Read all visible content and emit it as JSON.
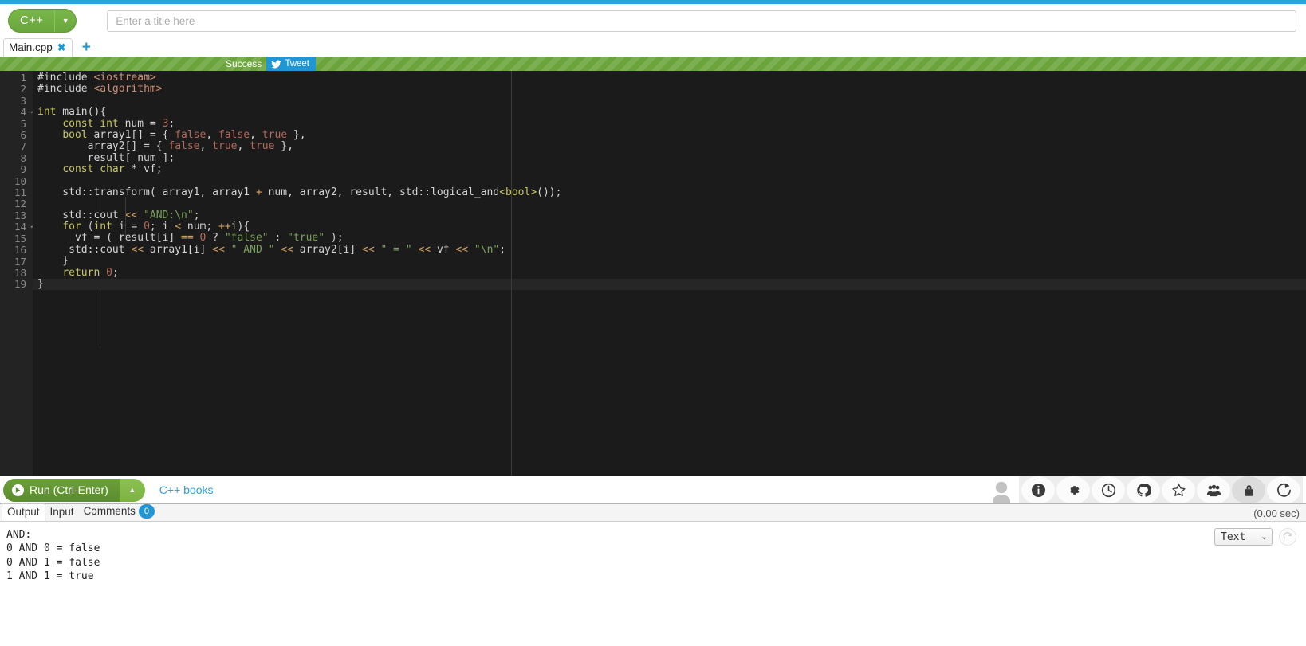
{
  "header": {
    "language": "C++",
    "language_caret": "▼",
    "title_placeholder": "Enter a title here",
    "title_value": ""
  },
  "tabs": {
    "files": [
      {
        "name": "Main.cpp",
        "close": "✖"
      }
    ],
    "add_label": "+"
  },
  "status": {
    "text": "Success",
    "tweet_label": "Tweet"
  },
  "editor": {
    "line_numbers": [
      "1",
      "2",
      "3",
      "4",
      "5",
      "6",
      "7",
      "8",
      "9",
      "10",
      "11",
      "12",
      "13",
      "14",
      "15",
      "16",
      "17",
      "18",
      "19"
    ],
    "lines": [
      [
        {
          "t": "#include ",
          "c": "t-pre"
        },
        {
          "t": "<iostream>",
          "c": "t-inc"
        }
      ],
      [
        {
          "t": "#include ",
          "c": "t-pre"
        },
        {
          "t": "<algorithm>",
          "c": "t-inc"
        }
      ],
      [],
      [
        {
          "t": "int",
          "c": "t-kw"
        },
        {
          "t": " main(){",
          "c": "t-plain"
        }
      ],
      [
        {
          "t": "    ",
          "c": "t-plain"
        },
        {
          "t": "const int",
          "c": "t-kw"
        },
        {
          "t": " num = ",
          "c": "t-plain"
        },
        {
          "t": "3",
          "c": "t-num"
        },
        {
          "t": ";",
          "c": "t-plain"
        }
      ],
      [
        {
          "t": "    ",
          "c": "t-plain"
        },
        {
          "t": "bool",
          "c": "t-kw"
        },
        {
          "t": " array1[] = { ",
          "c": "t-plain"
        },
        {
          "t": "false",
          "c": "t-bool"
        },
        {
          "t": ", ",
          "c": "t-plain"
        },
        {
          "t": "false",
          "c": "t-bool"
        },
        {
          "t": ", ",
          "c": "t-plain"
        },
        {
          "t": "true",
          "c": "t-bool"
        },
        {
          "t": " },",
          "c": "t-plain"
        }
      ],
      [
        {
          "t": "        array2[] = { ",
          "c": "t-plain"
        },
        {
          "t": "false",
          "c": "t-bool"
        },
        {
          "t": ", ",
          "c": "t-plain"
        },
        {
          "t": "true",
          "c": "t-bool"
        },
        {
          "t": ", ",
          "c": "t-plain"
        },
        {
          "t": "true",
          "c": "t-bool"
        },
        {
          "t": " },",
          "c": "t-plain"
        }
      ],
      [
        {
          "t": "        result[ num ];",
          "c": "t-plain"
        }
      ],
      [
        {
          "t": "    ",
          "c": "t-plain"
        },
        {
          "t": "const char",
          "c": "t-kw"
        },
        {
          "t": " * vf;",
          "c": "t-plain"
        }
      ],
      [],
      [
        {
          "t": "    std::transform( array1, array1 ",
          "c": "t-plain"
        },
        {
          "t": "+",
          "c": "t-op"
        },
        {
          "t": " num, array2, result, std::logical_and",
          "c": "t-plain"
        },
        {
          "t": "<bool>",
          "c": "t-tmpl"
        },
        {
          "t": "());",
          "c": "t-plain"
        }
      ],
      [],
      [
        {
          "t": "    std::cout ",
          "c": "t-plain"
        },
        {
          "t": "<<",
          "c": "t-op"
        },
        {
          "t": " ",
          "c": "t-plain"
        },
        {
          "t": "\"AND:\\n\"",
          "c": "t-str"
        },
        {
          "t": ";",
          "c": "t-plain"
        }
      ],
      [
        {
          "t": "    ",
          "c": "t-plain"
        },
        {
          "t": "for",
          "c": "t-kw"
        },
        {
          "t": " (",
          "c": "t-plain"
        },
        {
          "t": "int",
          "c": "t-kw"
        },
        {
          "t": " i = ",
          "c": "t-plain"
        },
        {
          "t": "0",
          "c": "t-num"
        },
        {
          "t": "; i ",
          "c": "t-plain"
        },
        {
          "t": "<",
          "c": "t-op"
        },
        {
          "t": " num; ",
          "c": "t-plain"
        },
        {
          "t": "++",
          "c": "t-op"
        },
        {
          "t": "i){",
          "c": "t-plain"
        }
      ],
      [
        {
          "t": "      vf = ( result[i] ",
          "c": "t-plain"
        },
        {
          "t": "==",
          "c": "t-op"
        },
        {
          "t": " ",
          "c": "t-plain"
        },
        {
          "t": "0",
          "c": "t-num"
        },
        {
          "t": " ? ",
          "c": "t-plain"
        },
        {
          "t": "\"false\"",
          "c": "t-str"
        },
        {
          "t": " : ",
          "c": "t-plain"
        },
        {
          "t": "\"true\"",
          "c": "t-str"
        },
        {
          "t": " );",
          "c": "t-plain"
        }
      ],
      [
        {
          "t": "     std::cout ",
          "c": "t-plain"
        },
        {
          "t": "<<",
          "c": "t-op"
        },
        {
          "t": " array1[i] ",
          "c": "t-plain"
        },
        {
          "t": "<<",
          "c": "t-op"
        },
        {
          "t": " ",
          "c": "t-plain"
        },
        {
          "t": "\" AND \"",
          "c": "t-str"
        },
        {
          "t": " ",
          "c": "t-plain"
        },
        {
          "t": "<<",
          "c": "t-op"
        },
        {
          "t": " array2[i] ",
          "c": "t-plain"
        },
        {
          "t": "<<",
          "c": "t-op"
        },
        {
          "t": " ",
          "c": "t-plain"
        },
        {
          "t": "\" = \"",
          "c": "t-str"
        },
        {
          "t": " ",
          "c": "t-plain"
        },
        {
          "t": "<<",
          "c": "t-op"
        },
        {
          "t": " vf ",
          "c": "t-plain"
        },
        {
          "t": "<<",
          "c": "t-op"
        },
        {
          "t": " ",
          "c": "t-plain"
        },
        {
          "t": "\"\\n\"",
          "c": "t-str"
        },
        {
          "t": ";",
          "c": "t-plain"
        }
      ],
      [
        {
          "t": "    }",
          "c": "t-plain"
        }
      ],
      [
        {
          "t": "    ",
          "c": "t-plain"
        },
        {
          "t": "return",
          "c": "t-kw"
        },
        {
          "t": " ",
          "c": "t-plain"
        },
        {
          "t": "0",
          "c": "t-num"
        },
        {
          "t": ";",
          "c": "t-plain"
        }
      ],
      [
        {
          "t": "}",
          "c": "t-plain"
        }
      ]
    ],
    "fold_lines": [
      4,
      14
    ],
    "current_line": 19
  },
  "toolbar": {
    "run_label": "Run (Ctrl-Enter)",
    "run_caret": "▲",
    "books_link": "C++ books",
    "icons": [
      {
        "name": "info-icon",
        "active": false
      },
      {
        "name": "gear-icon",
        "active": false
      },
      {
        "name": "history-icon",
        "active": false
      },
      {
        "name": "github-icon",
        "active": false
      },
      {
        "name": "star-icon",
        "active": false
      },
      {
        "name": "people-icon",
        "active": false
      },
      {
        "name": "lock-icon",
        "active": true
      },
      {
        "name": "share-icon",
        "active": false
      }
    ]
  },
  "output_panel": {
    "tabs": [
      {
        "label": "Output",
        "selected": true
      },
      {
        "label": "Input",
        "selected": false
      },
      {
        "label": "Comments",
        "selected": false,
        "badge": "0"
      }
    ],
    "timing": "(0.00 sec)",
    "format_value": "Text",
    "format_caret": "⌄",
    "console_lines": [
      "AND:",
      "0 AND 0 = false",
      "0 AND 1 = false",
      "1 AND 1 = true"
    ]
  },
  "colors": {
    "accent_blue": "#2196d4",
    "brand_green": "#6aa43a",
    "editor_bg": "#1b1b1b",
    "gutter_bg": "#232323"
  }
}
